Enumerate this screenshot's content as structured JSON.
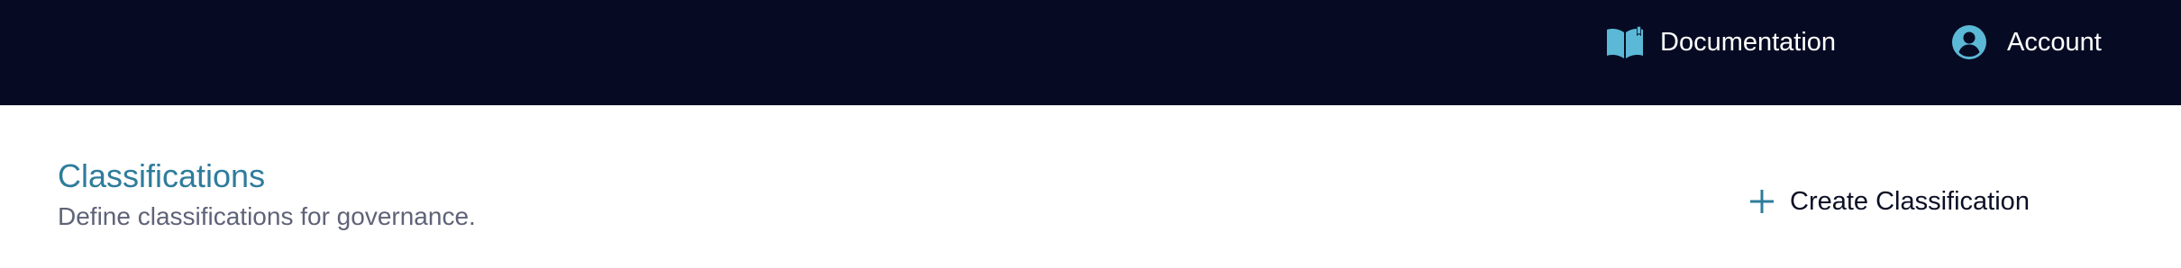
{
  "topbar": {
    "background": "#060b23",
    "nav": [
      {
        "label": "Documentation",
        "icon": "book-icon",
        "icon_color": "#5bb8d6"
      },
      {
        "label": "Account",
        "icon": "account-circle-icon",
        "icon_color": "#5bb8d6"
      }
    ]
  },
  "page": {
    "title": "Classifications",
    "subtitle": "Define classifications for governance.",
    "title_color": "#2e7c9c",
    "subtitle_color": "#5f6378"
  },
  "actions": {
    "create_label": "Create Classification",
    "create_icon": "plus-icon",
    "accent": "#2e7c9c"
  }
}
